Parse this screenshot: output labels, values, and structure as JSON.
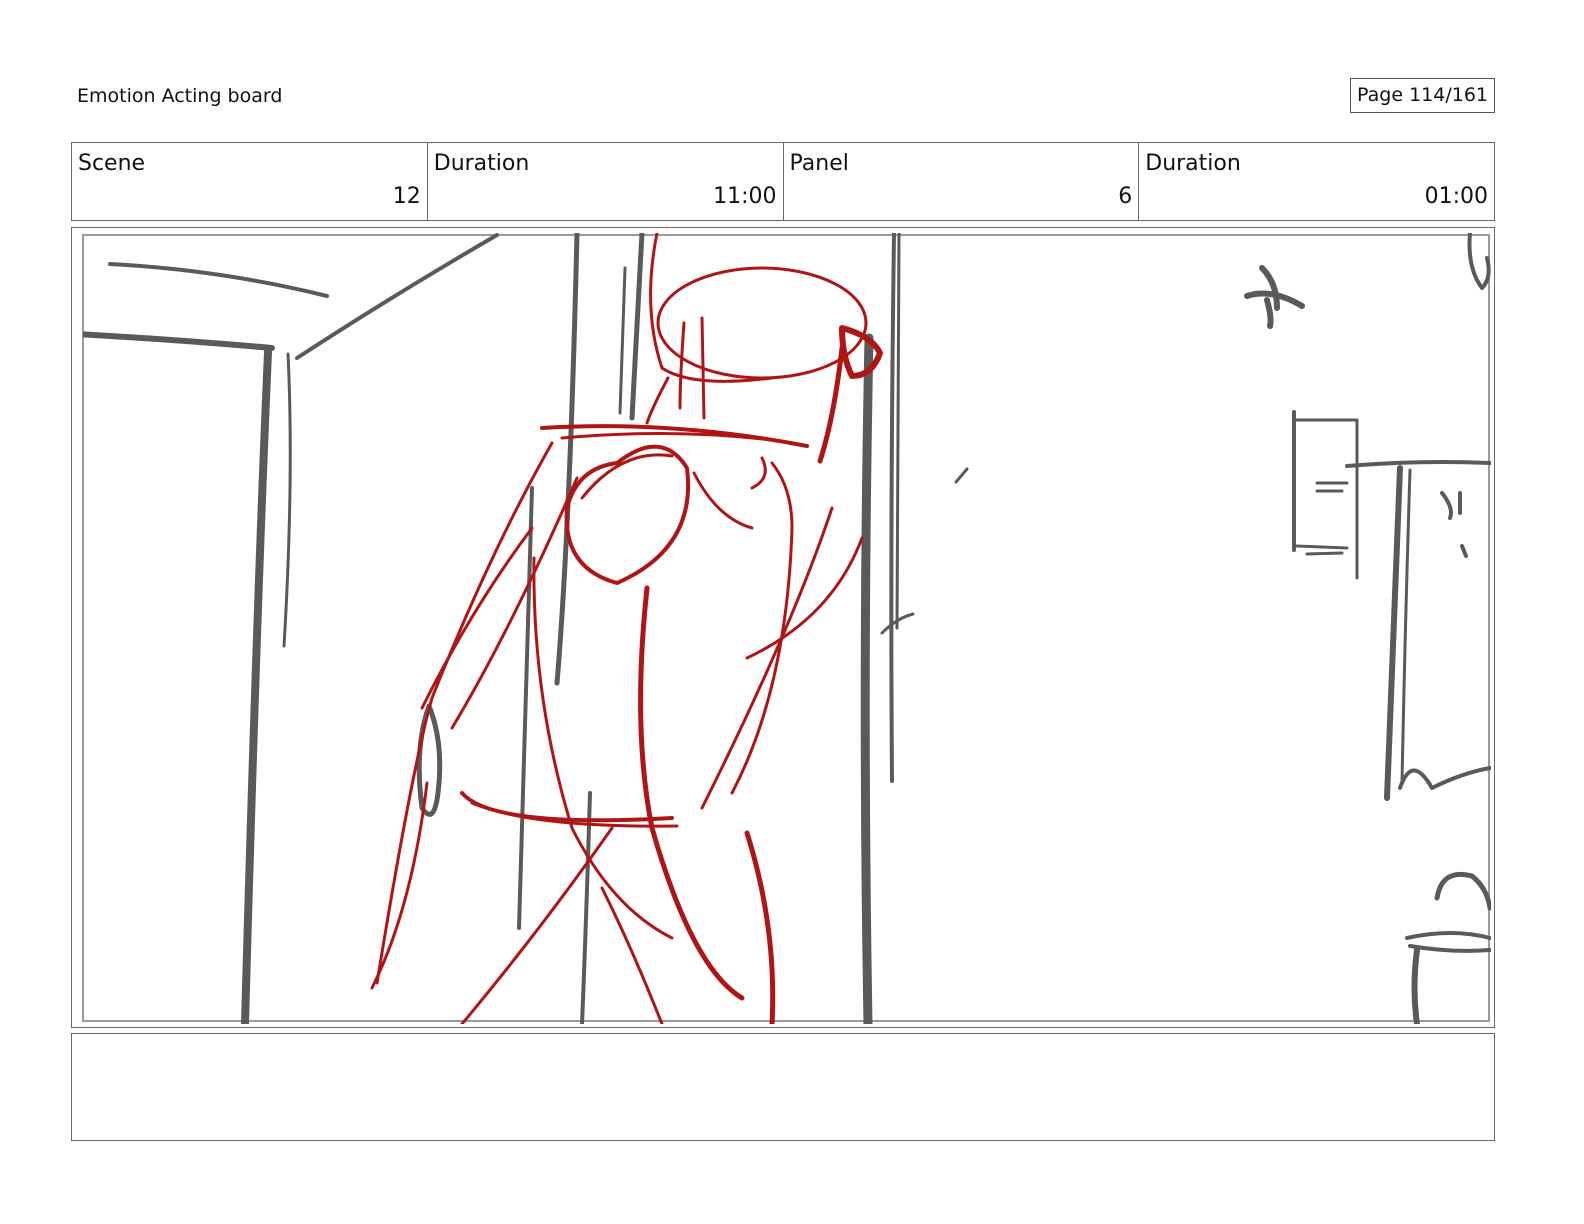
{
  "header": {
    "title": "Emotion Acting board",
    "page": "Page 114/161"
  },
  "info": {
    "scene_label": "Scene",
    "scene_value": "12",
    "duration_label": "Duration",
    "duration_value": "11:00",
    "panel_label": "Panel",
    "panel_value": "6",
    "panel_duration_label": "Duration",
    "panel_duration_value": "01:00"
  },
  "notes": {
    "text": ""
  },
  "colors": {
    "sketch_gray": "#5a5a5a",
    "sketch_red": "#b01515",
    "border": "#666666"
  }
}
